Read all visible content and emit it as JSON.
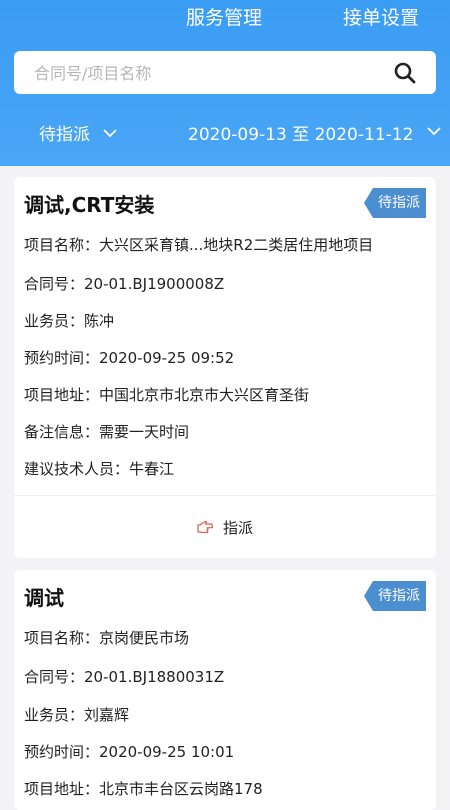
{
  "header": {
    "tabs": [
      {
        "label": "服务管理"
      },
      {
        "label": "接单设置"
      }
    ],
    "search": {
      "placeholder": "合同号/项目名称",
      "value": ""
    },
    "filters": {
      "status": "待指派",
      "date_range": "2020-09-13 至 2020-11-12"
    },
    "accent_color": "#3a9cf3"
  },
  "orders": [
    {
      "title": "调试,CRT安装",
      "badge": "待指派",
      "fields": [
        "项目名称：大兴区采育镇...地块R2二类居住用地项目",
        "合同号：20-01.BJ1900008Z",
        "业务员：陈冲",
        "预约时间：2020-09-25 09:52",
        "项目地址：中国北京市北京市大兴区育圣街",
        "备注信息：需要一天时间",
        "建议技术人员：牛春江"
      ],
      "action_label": "指派"
    },
    {
      "title": "调试",
      "badge": "待指派",
      "fields": [
        "项目名称：京岗便民市场",
        "合同号：20-01.BJ1880031Z",
        "业务员：刘嘉辉",
        "预约时间：2020-09-25 10:01",
        "项目地址：北京市丰台区云岗路178"
      ]
    }
  ]
}
